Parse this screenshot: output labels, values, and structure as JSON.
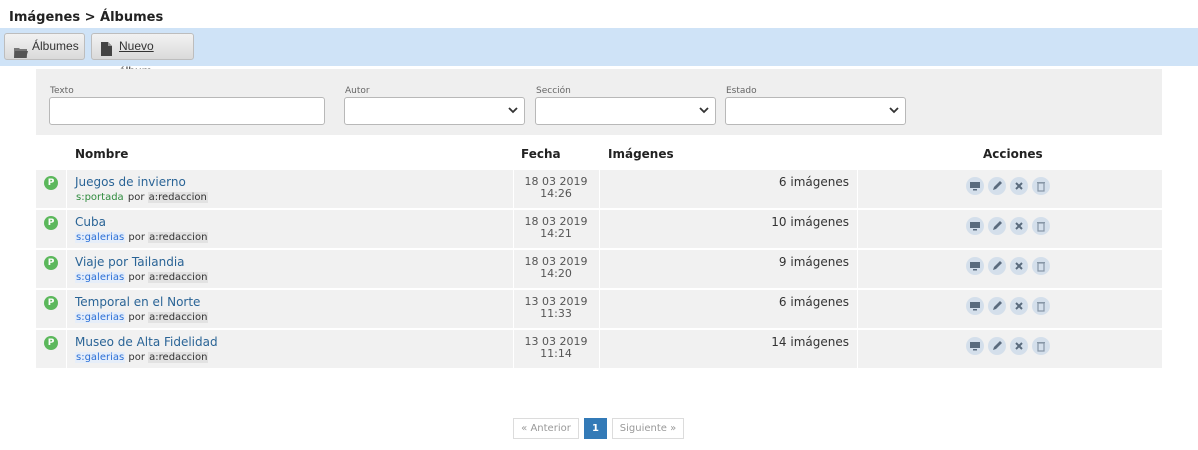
{
  "breadcrumb": "Imágenes > Álbumes",
  "toolbar": {
    "albums_label": "Álbumes",
    "new_album_label": "Nuevo álbum"
  },
  "filters": {
    "texto_label": "Texto",
    "texto_value": "",
    "autor_label": "Autor",
    "autor_value": "",
    "seccion_label": "Sección",
    "seccion_value": "",
    "estado_label": "Estado",
    "estado_value": ""
  },
  "table": {
    "headers": {
      "nombre": "Nombre",
      "fecha": "Fecha",
      "imagenes": "Imágenes",
      "acciones": "Acciones"
    },
    "rows": [
      {
        "status": "P",
        "title": "Juegos de invierno",
        "section": "s:portada",
        "por": "por",
        "author": "a:redaccion",
        "date": "18 03 2019",
        "time": "14:26",
        "images": "6 imágenes"
      },
      {
        "status": "P",
        "title": "Cuba",
        "section": "s:galerias",
        "por": "por",
        "author": "a:redaccion",
        "date": "18 03 2019",
        "time": "14:21",
        "images": "10 imágenes"
      },
      {
        "status": "P",
        "title": "Viaje por Tailandia",
        "section": "s:galerias",
        "por": "por",
        "author": "a:redaccion",
        "date": "18 03 2019",
        "time": "14:20",
        "images": "9 imágenes"
      },
      {
        "status": "P",
        "title": "Temporal en el Norte",
        "section": "s:galerias",
        "por": "por",
        "author": "a:redaccion",
        "date": "13 03 2019",
        "time": "11:33",
        "images": "6 imágenes"
      },
      {
        "status": "P",
        "title": "Museo de Alta Fidelidad",
        "section": "s:galerias",
        "por": "por",
        "author": "a:redaccion",
        "date": "13 03 2019",
        "time": "11:14",
        "images": "14 imágenes"
      }
    ],
    "row_actions": [
      "monitor-icon",
      "pencil-icon",
      "close-icon",
      "trash-icon"
    ]
  },
  "pagination": {
    "prev": "« Anterior",
    "current": "1",
    "next": "Siguiente »"
  },
  "colors": {
    "toolbar_bg": "#cfe3f7",
    "status_published": "#5cb85c",
    "link": "#2a6496",
    "pager_active": "#337ab7"
  }
}
